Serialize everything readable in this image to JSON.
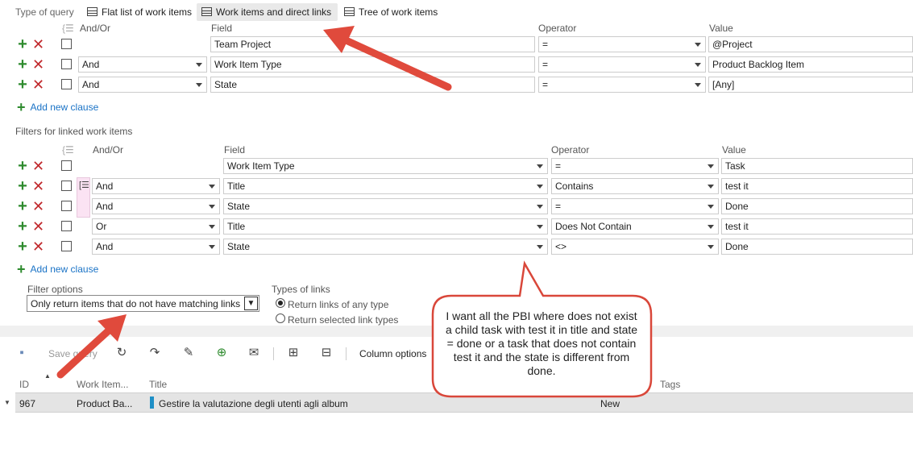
{
  "query_type": {
    "label": "Type of query",
    "options": [
      "Flat list of work items",
      "Work items and direct links",
      "Tree of work items"
    ],
    "selected": "Work items and direct links"
  },
  "top_headers": {
    "andor": "And/Or",
    "field": "Field",
    "operator": "Operator",
    "value": "Value"
  },
  "top_clauses": [
    {
      "andor": "",
      "field": "Team Project",
      "operator": "=",
      "value": "@Project"
    },
    {
      "andor": "And",
      "field": "Work Item Type",
      "operator": "=",
      "value": "Product Backlog Item"
    },
    {
      "andor": "And",
      "field": "State",
      "operator": "=",
      "value": "[Any]"
    }
  ],
  "add_new_clause": "Add new clause",
  "linked_section_title": "Filters for linked work items",
  "linked_headers": {
    "andor": "And/Or",
    "field": "Field",
    "operator": "Operator",
    "value": "Value"
  },
  "linked_clauses": [
    {
      "andor": "",
      "field": "Work Item Type",
      "operator": "=",
      "value": "Task"
    },
    {
      "andor": "And",
      "field": "Title",
      "operator": "Contains",
      "value": "test it"
    },
    {
      "andor": "And",
      "field": "State",
      "operator": "=",
      "value": "Done"
    },
    {
      "andor": "Or",
      "field": "Title",
      "operator": "Does Not Contain",
      "value": "test it"
    },
    {
      "andor": "And",
      "field": "State",
      "operator": "<>",
      "value": "Done"
    }
  ],
  "filter_options": {
    "label": "Filter options",
    "selected": "Only return items that do not have matching links"
  },
  "types_of_links": {
    "label": "Types of links",
    "options": [
      "Return links of any type",
      "Return selected link types"
    ],
    "selected_index": 0
  },
  "toolbar": {
    "save_query": "Save query",
    "column_options": "Column options"
  },
  "results": {
    "columns": [
      "ID",
      "Work Item...",
      "Title",
      "Tags"
    ],
    "rows": [
      {
        "id": "967",
        "type": "Product Ba...",
        "title": "Gestire la valutazione degli utenti agli album",
        "state": "New"
      }
    ]
  },
  "callout": {
    "text": "I want all the PBI where does not exist a child task with test it in title and state = done or a task that does not contain test it and the state is different from done."
  },
  "colors": {
    "arrow": "#e04a3c",
    "link_blue": "#1a73c6",
    "add_green": "#2e8b2e",
    "delete_red": "#c0282c",
    "title_bar_accent": "#1e8fc6",
    "grouping_pink": "#fbe3f3"
  }
}
